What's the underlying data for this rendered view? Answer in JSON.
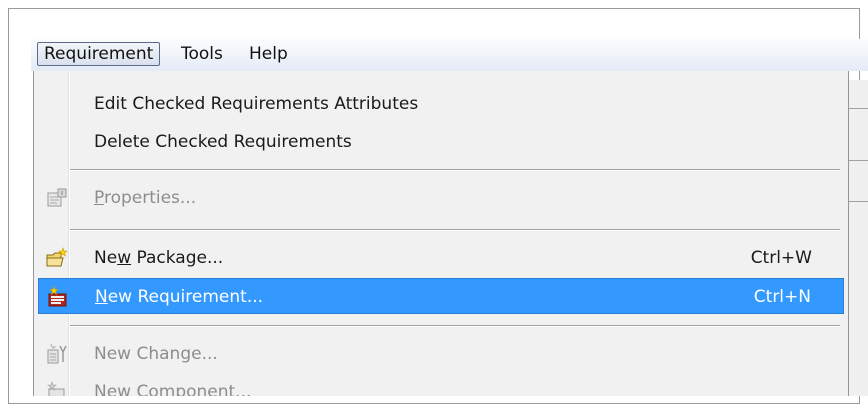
{
  "menubar": {
    "items": [
      {
        "label": "Requirement"
      },
      {
        "label": "Tools"
      },
      {
        "label": "Help"
      }
    ]
  },
  "menu": {
    "edit_attributes": {
      "label": "Edit Checked Requirements Attributes"
    },
    "delete_checked": {
      "label": "Delete Checked Requirements"
    },
    "properties": {
      "label_pre": "",
      "mnemonic": "P",
      "label_post": "roperties...",
      "icon": "properties-icon"
    },
    "new_package": {
      "label_pre": "Ne",
      "mnemonic": "w",
      "label_post": " Package...",
      "shortcut": "Ctrl+W",
      "icon": "new-package-icon"
    },
    "new_requirement": {
      "label_pre": "",
      "mnemonic": "N",
      "label_post": "ew Requirement...",
      "shortcut": "Ctrl+N",
      "icon": "new-requirement-icon"
    },
    "new_change": {
      "label": "New Change...",
      "icon": "new-change-icon"
    },
    "new_component": {
      "label": "New Component...",
      "icon": "new-component-icon"
    }
  },
  "colors": {
    "highlight": "#3399ff",
    "menu_bg": "#f1f1f1",
    "disabled_text": "#8d8d8d"
  }
}
